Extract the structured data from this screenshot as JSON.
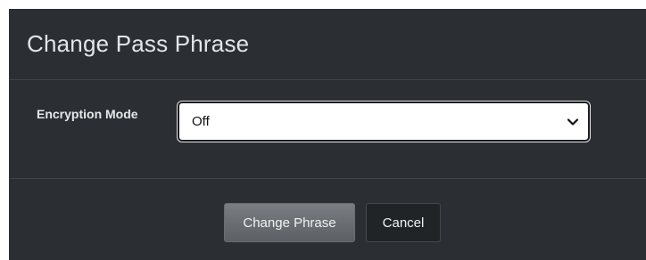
{
  "dialog": {
    "title": "Change Pass Phrase"
  },
  "form": {
    "encryption_mode_label": "Encryption Mode",
    "encryption_mode_value": "Off"
  },
  "footer": {
    "change_button_label": "Change Phrase",
    "cancel_button_label": "Cancel"
  },
  "icons": {
    "dropdown": "chevron-down-icon"
  },
  "colors": {
    "dialog_background": "#2b2f33",
    "primary_button": "#6b6f73",
    "cancel_button": "#212427"
  }
}
